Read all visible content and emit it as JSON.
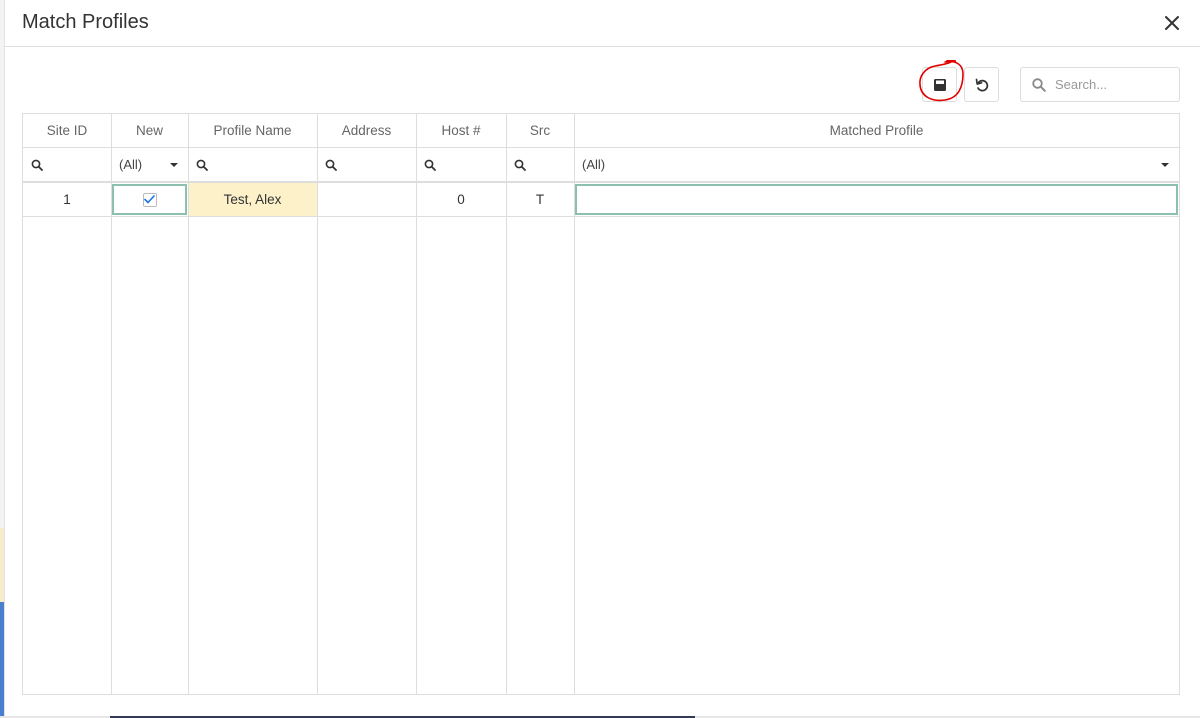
{
  "dialog": {
    "title": "Match Profiles"
  },
  "toolbar": {
    "save_icon": "save-icon",
    "revert_icon": "undo-icon",
    "search_placeholder": "Search...",
    "search_value": ""
  },
  "grid": {
    "columns": [
      "Site ID",
      "New",
      "Profile Name",
      "Address",
      "Host #",
      "Src",
      "Matched Profile"
    ],
    "filters": {
      "new": "(All)",
      "matched_profile": "(All)"
    },
    "rows": [
      {
        "site_id": "1",
        "new_checked": true,
        "profile_name": "Test, Alex",
        "address": "",
        "host": "0",
        "src": "T",
        "matched_profile": ""
      }
    ]
  },
  "colors": {
    "focus_border": "#8cc0ae",
    "highlight_cell": "#fdf1ca",
    "checkmark": "#1a73e8",
    "annotation": "#e00000"
  }
}
